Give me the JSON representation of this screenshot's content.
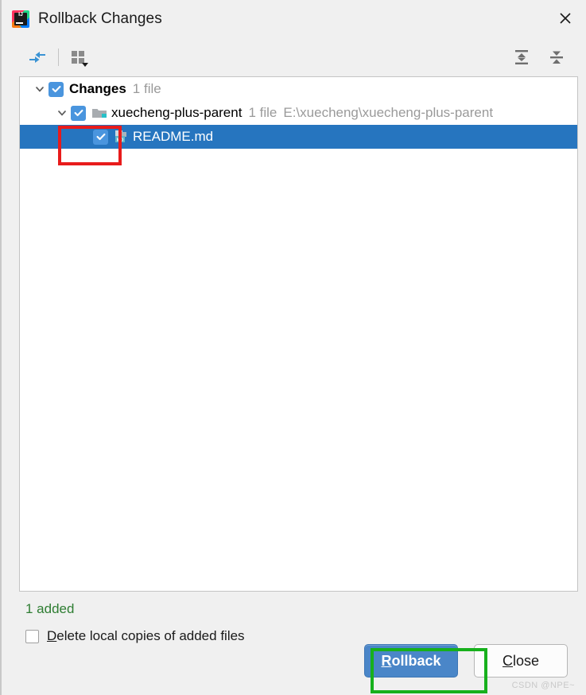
{
  "window": {
    "title": "Rollback Changes",
    "app_icon": "intellij-idea-icon",
    "close_icon": "close-icon"
  },
  "toolbar": {
    "left": [
      {
        "name": "revert-selected-icon",
        "tooltip": "Revert Selected"
      },
      {
        "name": "group-by-icon",
        "tooltip": "Group By"
      }
    ],
    "right": [
      {
        "name": "expand-all-icon",
        "tooltip": "Expand All"
      },
      {
        "name": "collapse-all-icon",
        "tooltip": "Collapse All"
      }
    ]
  },
  "tree": {
    "rows": [
      {
        "label": "Changes",
        "count": "1 file",
        "path": "",
        "checked": true,
        "expanded": true,
        "selected": false,
        "icon": ""
      },
      {
        "label": "xuecheng-plus-parent",
        "count": "1 file",
        "path": "E:\\xuecheng\\xuecheng-plus-parent",
        "checked": true,
        "expanded": true,
        "selected": false,
        "icon": "folder-icon"
      },
      {
        "label": "README.md",
        "count": "",
        "path": "",
        "checked": true,
        "expanded": false,
        "selected": true,
        "icon": "markdown-file-icon"
      }
    ]
  },
  "status": {
    "text": "1 added",
    "color": "#2e7d32"
  },
  "options": {
    "delete_local_copies": {
      "label_mnemonic": "D",
      "label_rest": "elete local copies of added files",
      "checked": false
    }
  },
  "buttons": {
    "rollback": {
      "mnemonic": "R",
      "rest": "ollback"
    },
    "close": {
      "mnemonic": "C",
      "rest": "lose"
    }
  },
  "annotations": [
    {
      "name": "red-highlight-checkbox",
      "color": "#e81b1b"
    },
    {
      "name": "green-highlight-rollback",
      "color": "#17b01c"
    }
  ],
  "watermark": {
    "text": "CSDN @NPE~"
  }
}
